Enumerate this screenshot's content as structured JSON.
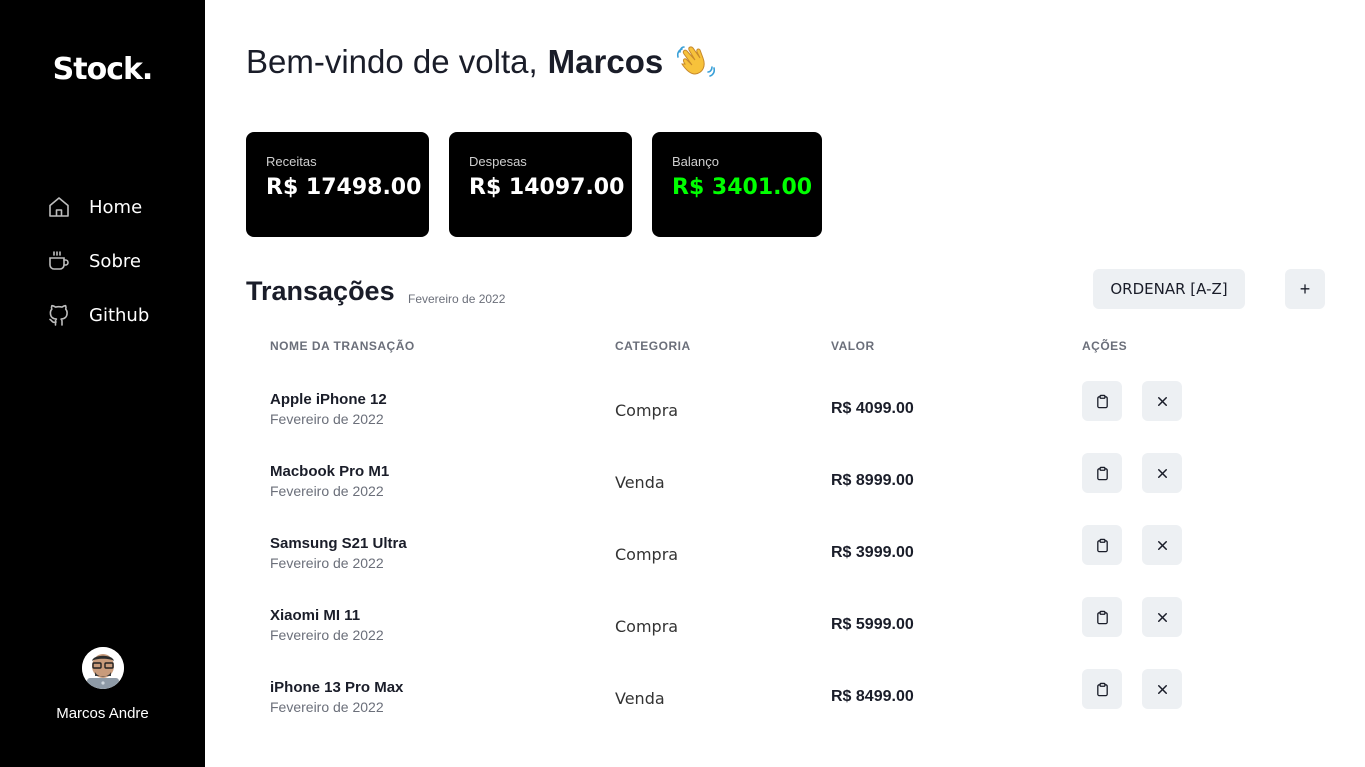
{
  "app": {
    "logo": "Stock."
  },
  "sidebar": {
    "items": [
      {
        "label": "Home",
        "icon": "home-icon"
      },
      {
        "label": "Sobre",
        "icon": "coffee-icon"
      },
      {
        "label": "Github",
        "icon": "github-icon"
      }
    ],
    "user": {
      "name": "Marcos Andre",
      "avatar": "avatar"
    }
  },
  "header": {
    "greeting": "Bem-vindo de volta,",
    "name": "Marcos",
    "emoji": "waving-hand-icon"
  },
  "summary": [
    {
      "label": "Receitas",
      "value": "R$ 17498.00",
      "color": "#ffffff"
    },
    {
      "label": "Despesas",
      "value": "R$ 14097.00",
      "color": "#ffffff"
    },
    {
      "label": "Balanço",
      "value": "R$ 3401.00",
      "color": "#00ff00"
    }
  ],
  "transactions": {
    "title": "Transações",
    "subtitle": "Fevereiro de 2022",
    "sort_label": "ORDENAR [A-Z]",
    "add_label": "+",
    "columns": [
      "NOME DA TRANSAÇÃO",
      "CATEGORIA",
      "VALOR",
      "AÇÕES"
    ],
    "rows": [
      {
        "name": "Apple iPhone 12",
        "date": "Fevereiro de 2022",
        "category": "Compra",
        "value": "R$ 4099.00"
      },
      {
        "name": "Macbook Pro M1",
        "date": "Fevereiro de 2022",
        "category": "Venda",
        "value": "R$ 8999.00"
      },
      {
        "name": "Samsung S21 Ultra",
        "date": "Fevereiro de 2022",
        "category": "Compra",
        "value": "R$ 3999.00"
      },
      {
        "name": "Xiaomi MI 11",
        "date": "Fevereiro de 2022",
        "category": "Compra",
        "value": "R$ 5999.00"
      },
      {
        "name": "iPhone 13 Pro Max",
        "date": "Fevereiro de 2022",
        "category": "Venda",
        "value": "R$ 8499.00"
      }
    ]
  },
  "colors": {
    "sidebar_bg": "#000000",
    "button_bg": "#edf0f3",
    "balance_positive": "#00ff00"
  }
}
